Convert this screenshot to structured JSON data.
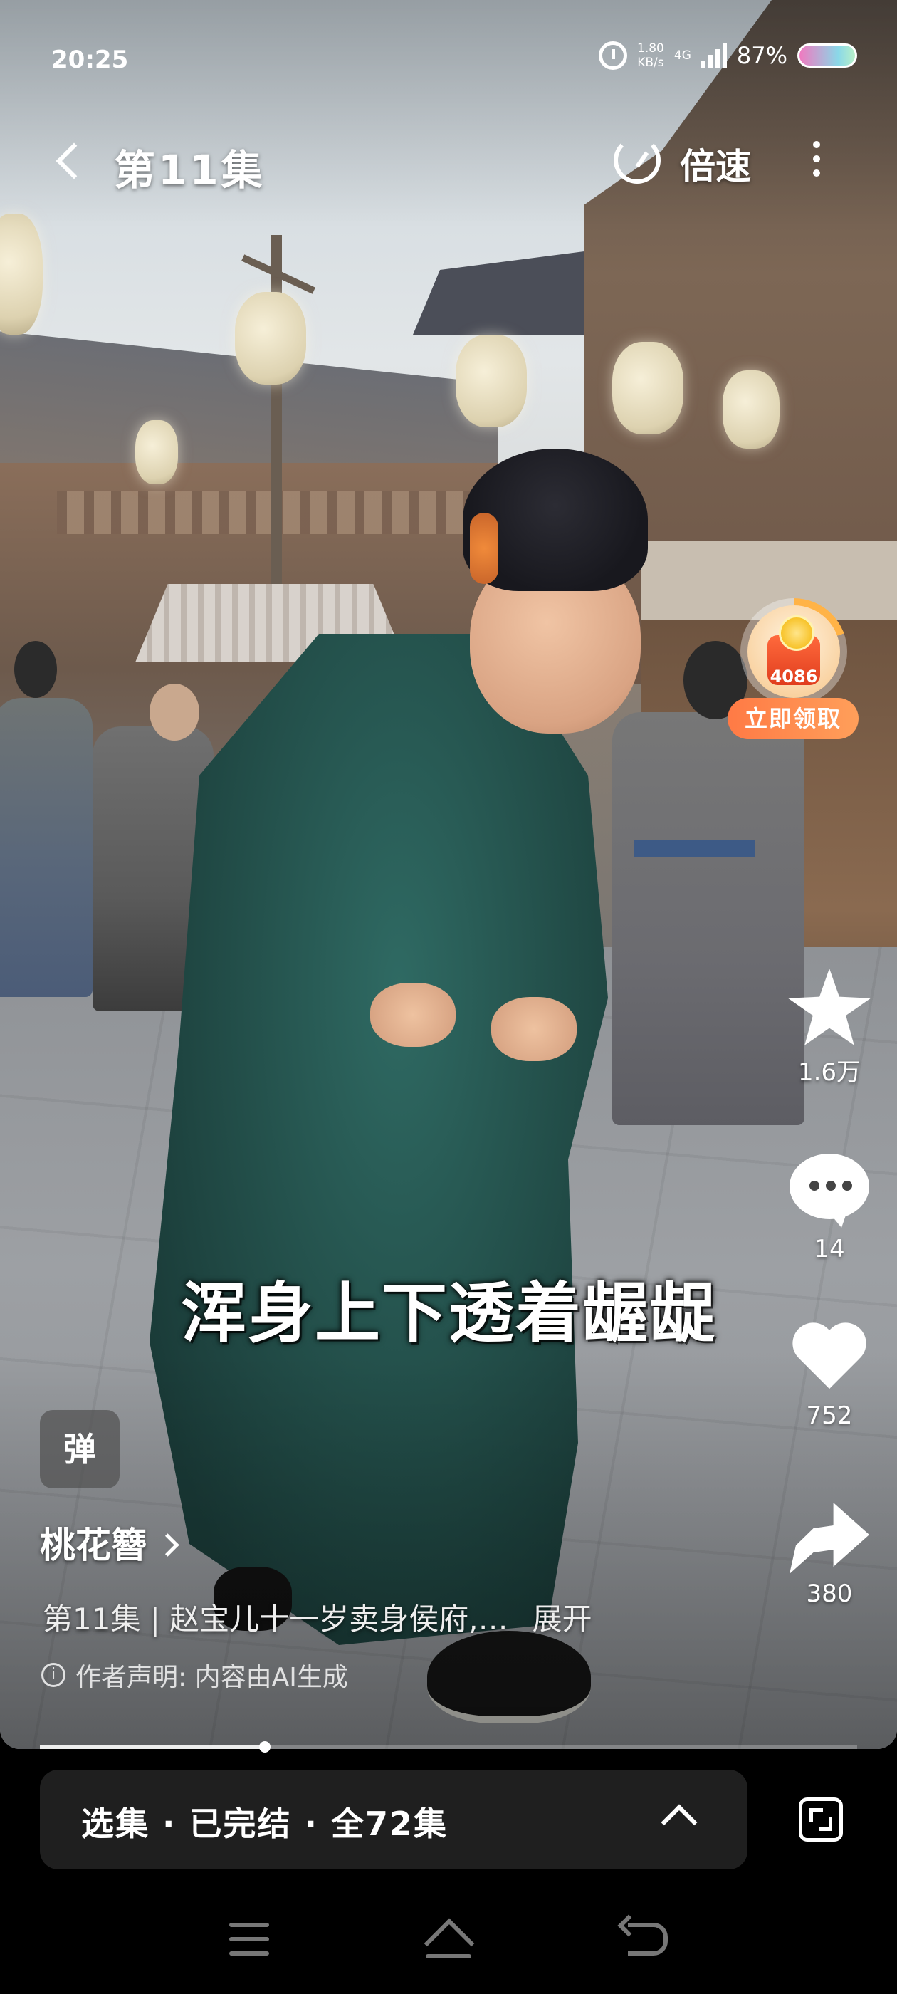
{
  "status_bar": {
    "time": "20:25",
    "net_speed_value": "1.80",
    "net_speed_unit": "KB/s",
    "network_type": "4G",
    "battery_percent": "87%"
  },
  "header": {
    "episode_title": "第11集",
    "speed_label": "倍速"
  },
  "reward": {
    "amount": "4086",
    "button_label": "立即领取"
  },
  "actions": {
    "favorite_count": "1.6万",
    "comment_count": "14",
    "like_count": "752",
    "share_count": "380"
  },
  "video": {
    "subtitle": "浑身上下透着龌龊",
    "progress_fraction": 0.275
  },
  "info": {
    "danmu_label": "弹",
    "drama_name": "桃花簪",
    "description": "第11集 | 赵宝儿十一岁卖身侯府,…",
    "expand_label": "展开",
    "ai_notice": "作者声明: 内容由AI生成"
  },
  "episodes_bar": {
    "label": "选集 · 已完结 · 全72集"
  },
  "colors": {
    "reward_button": "#ff8a4c",
    "background": "#000000",
    "episodes_bar": "#1f1f1f"
  }
}
